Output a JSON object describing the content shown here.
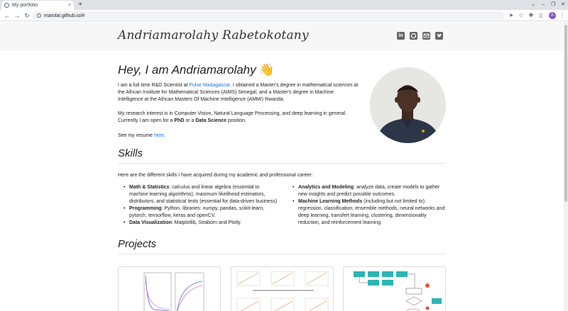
{
  "browser": {
    "tab_title": "My portfolio",
    "tab_close": "×",
    "new_tab": "+",
    "url": "marolai.github.io/#",
    "profile_initial": "A",
    "win_minimize": "–",
    "win_restore": "❐",
    "win_close": "✕",
    "icons": [
      "back-icon",
      "forward-icon",
      "reload-icon",
      "send-icon",
      "star-icon",
      "extensions-icon",
      "sidebar-icon",
      "menu-icon"
    ]
  },
  "header": {
    "brand": "Andriamarolahy Rabetokotany",
    "social": [
      "linkedin-icon",
      "github-icon",
      "email-icon",
      "twitter-icon"
    ]
  },
  "hero": {
    "title": "Hey, I am Andriamarolahy",
    "wave": "👋",
    "p1_pre": "I am a full time R&D Scientist at ",
    "p1_link": "Pulse Madagascar",
    "p1_post": ". I obtained a Master's degree in mathematical sciences at the African Institute for Mathematical Sciences (AIMS) Senegal, and a Master's degree in Machine Intelligence at the African Masters Of Machine Intelligence (AMMI) Rwanda.",
    "p2_pre": "My research interest is in Computer Vision, Natural Language Processing, and deep learning in general. Currently I am open for a ",
    "p2_b1": "PhD",
    "p2_mid": " or a ",
    "p2_b2": "Data Science",
    "p2_post": " position.",
    "p3_pre": "See my resume ",
    "p3_link": "here",
    "p3_post": "."
  },
  "skills": {
    "title": "Skills",
    "intro": "Here are the different skills I have acquired during my academic and professional career:",
    "left": [
      {
        "b": "Math & Statistics",
        "t": ": calculus and linear algebra (essential to machine learning algorithms), maximum likelihood estimators, distributors, and statistical tests (essential for data-driven business)"
      },
      {
        "b": "Programming",
        "t": ": Python, libraries: numpy, pandas, scikit-learn, pytorch, tensorflow, keras and openCV."
      },
      {
        "b": "Data Visualization",
        "t": ": Matplotlib, Seaborn and Plotly."
      }
    ],
    "right": [
      {
        "b": "Analytics and Modeling",
        "t": ": analyze data, create models to gather new insights and predict possible outcomes."
      },
      {
        "b": "Machine Learning Methods",
        "t": " (including but not limited to): regression, classification, ensemble methods, neural networks and deep learning, transfert learning, clustering, dimensionality reduction, and reinforcement learning."
      }
    ]
  },
  "projects": {
    "title": "Projects"
  },
  "colors": {
    "accent": "#1a73e8",
    "text": "#222222",
    "header_bg": "#f7f7f7",
    "social": "#666666",
    "profile": "#7e57c2"
  }
}
